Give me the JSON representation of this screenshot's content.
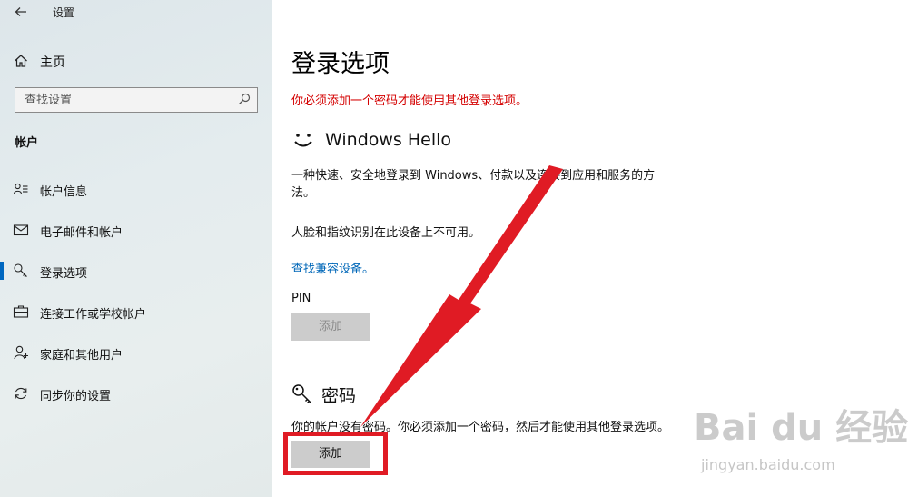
{
  "window": {
    "title": "设置"
  },
  "sidebar": {
    "home_label": "主页",
    "search_placeholder": "查找设置",
    "section_title": "帐户",
    "items": [
      {
        "label": "帐户信息",
        "icon": "user-info-icon",
        "selected": false
      },
      {
        "label": "电子邮件和帐户",
        "icon": "mail-icon",
        "selected": false
      },
      {
        "label": "登录选项",
        "icon": "key-icon",
        "selected": true
      },
      {
        "label": "连接工作或学校帐户",
        "icon": "briefcase-icon",
        "selected": false
      },
      {
        "label": "家庭和其他用户",
        "icon": "person-add-icon",
        "selected": false
      },
      {
        "label": "同步你的设置",
        "icon": "sync-icon",
        "selected": false
      }
    ],
    "accent_color": "#0067c0"
  },
  "main": {
    "title": "登录选项",
    "warning": "你必须添加一个密码才能使用其他登录选项。",
    "warning_color": "#d40000",
    "hello": {
      "title": "Windows Hello",
      "desc_line1": "一种快速、安全地登录到 Windows、付款以及连接到应用和服务的方",
      "desc_line2": "法。",
      "unavailable": "人脸和指纹识别在此设备上不可用。",
      "link": "查找兼容设备。",
      "pin_label": "PIN",
      "pin_button": "添加"
    },
    "password": {
      "title": "密码",
      "desc": "你的帐户没有密码。你必须添加一个密码，然后才能使用其他登录选项。",
      "button": "添加"
    }
  },
  "annotation": {
    "color": "#e01b24"
  },
  "watermark": {
    "logo": "Bai du 经验",
    "sub": "jingyan.baidu.com"
  }
}
